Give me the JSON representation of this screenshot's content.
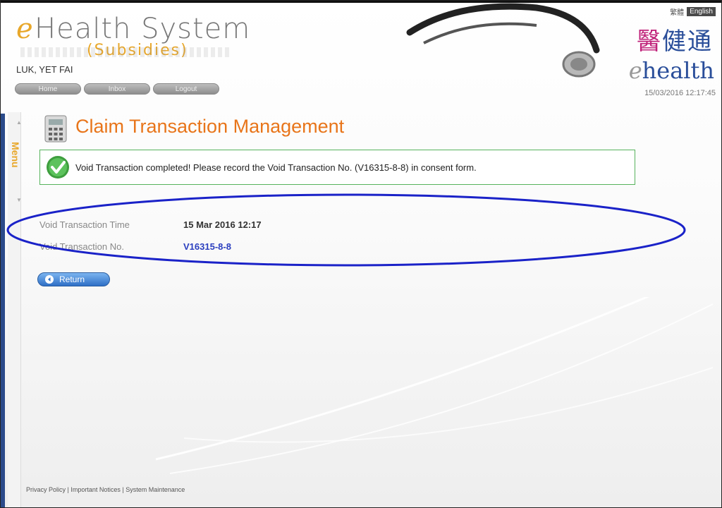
{
  "header": {
    "logo_e": "e",
    "title": "Health System",
    "subtitle": "(Subsidies)",
    "username": "LUK, YET FAI",
    "nav": [
      "Home",
      "Inbox",
      "Logout"
    ],
    "lang_zh": "繁體",
    "lang_en": "English",
    "brand_zh_highlight": "醫",
    "brand_zh_rest": "健通",
    "brand_en_e": "e",
    "brand_en_rest": "health",
    "datetime": "15/03/2016 12:17:45"
  },
  "sidebar": {
    "menu_label": "Menu"
  },
  "page": {
    "title": "Claim Transaction Management",
    "message": "Void Transaction completed! Please record the Void Transaction No. (V16315-8-8) in consent form.",
    "fields": [
      {
        "label": "Void Transaction Time",
        "value": "15 Mar 2016 12:17"
      },
      {
        "label": "Void Transaction No.",
        "value": "V16315-8-8"
      }
    ],
    "return_label": "Return"
  },
  "footer": {
    "privacy": "Privacy Policy",
    "sep1": " | ",
    "notices": "Important Notices",
    "sep2": " | ",
    "maintenance": "System Maintenance"
  },
  "colors": {
    "accent_orange": "#e8751a",
    "brand_blue": "#2a4e9a",
    "success_green": "#56b35c",
    "link_blue": "#2b3fbf",
    "annotation_ellipse": "#1a22c8"
  }
}
